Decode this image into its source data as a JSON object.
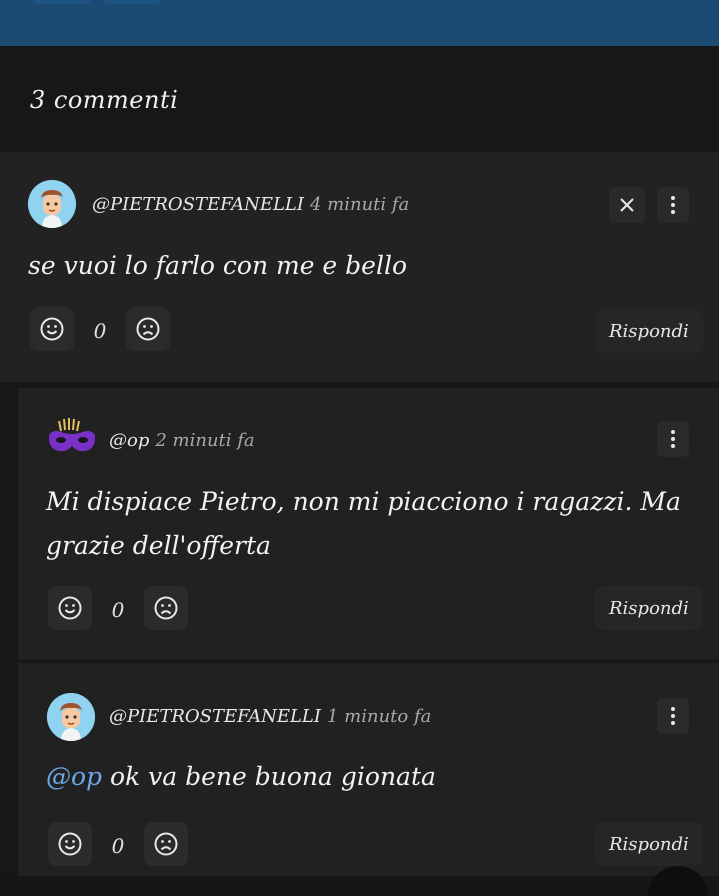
{
  "header": {
    "comment_count_label": "3 commenti"
  },
  "comments": [
    {
      "user": "@PIETROSTEFANELLI",
      "time": "4 minuti fa",
      "body": "se vuoi lo farlo con me e bello",
      "votes": "0",
      "reply_label": "Rispondi",
      "avatar_icon": "boy-avatar-icon"
    },
    {
      "user": "@op",
      "time": "2 minuti fa",
      "body_line1": "Mi dispiace Pietro, non mi piacciono i ragazzi. Ma",
      "body_line2": "grazie dell'offerta",
      "votes": "0",
      "reply_label": "Rispondi",
      "avatar_icon": "purple-mask-icon"
    },
    {
      "user": "@PIETROSTEFANELLI",
      "time": "1 minuto fa",
      "mention": "@op",
      "body": "ok va bene buona gionata",
      "votes": "0",
      "reply_label": "Rispondi",
      "avatar_icon": "boy-avatar-icon"
    }
  ],
  "colors": {
    "topbar": "#1b4a73",
    "mention": "#6ba6e8",
    "card": "#212121",
    "background": "#161616"
  }
}
